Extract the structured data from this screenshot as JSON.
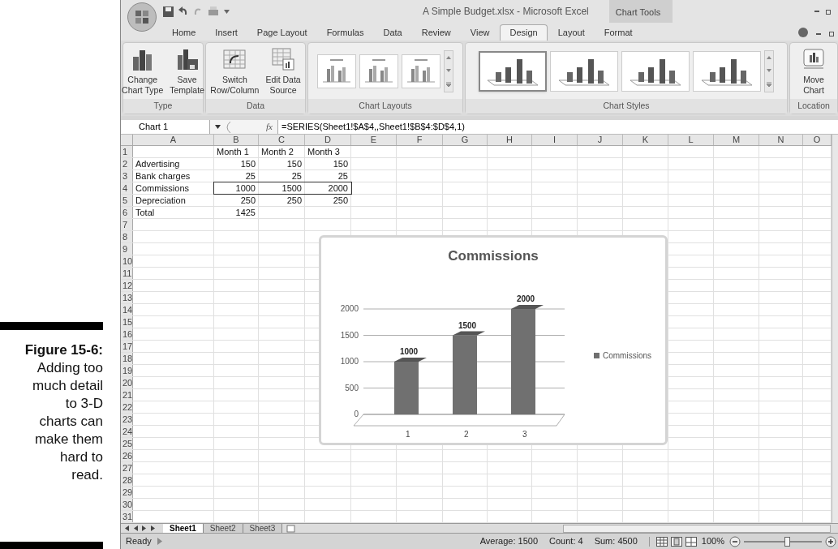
{
  "caption": {
    "label": "Figure 15-6:",
    "text": "Adding too much detail to 3-D charts can make them hard to read."
  },
  "window": {
    "title": "A Simple Budget.xlsx - Microsoft Excel",
    "contextual_group": "Chart Tools"
  },
  "ribbon_tabs": [
    {
      "label": "Home",
      "selected": false
    },
    {
      "label": "Insert",
      "selected": false
    },
    {
      "label": "Page Layout",
      "selected": false
    },
    {
      "label": "Formulas",
      "selected": false
    },
    {
      "label": "Data",
      "selected": false
    },
    {
      "label": "Review",
      "selected": false
    },
    {
      "label": "View",
      "selected": false
    },
    {
      "label": "Design",
      "selected": true
    },
    {
      "label": "Layout",
      "selected": false
    },
    {
      "label": "Format",
      "selected": false
    }
  ],
  "ribbon_groups": [
    {
      "label": "Type",
      "kind": "buttons",
      "buttons": [
        {
          "lines": [
            "Change",
            "Chart Type"
          ]
        },
        {
          "lines": [
            "Save",
            "Template"
          ]
        }
      ]
    },
    {
      "label": "Data",
      "kind": "buttons",
      "buttons": [
        {
          "lines": [
            "Switch",
            "Row/Column"
          ]
        },
        {
          "lines": [
            "Edit Data",
            "Source"
          ]
        }
      ]
    },
    {
      "label": "Chart Layouts",
      "kind": "gallery",
      "items": [
        {
          "selected": false
        },
        {
          "selected": false
        },
        {
          "selected": false
        }
      ]
    },
    {
      "label": "Chart Styles",
      "kind": "gallery",
      "items": [
        {
          "selected": true
        },
        {
          "selected": false
        },
        {
          "selected": false
        },
        {
          "selected": false
        }
      ]
    },
    {
      "label": "Location",
      "kind": "buttons",
      "buttons": [
        {
          "lines": [
            "Move",
            "Chart"
          ]
        }
      ]
    }
  ],
  "formula_bar": {
    "name_box": "Chart 1",
    "function_label": "fx",
    "formula": "=SERIES(Sheet1!$A$4,,Sheet1!$B$4:$D$4,1)"
  },
  "sheet": {
    "columns": [
      "A",
      "B",
      "C",
      "D",
      "E",
      "F",
      "G",
      "H",
      "I",
      "J",
      "K",
      "L",
      "M",
      "N",
      "O"
    ],
    "rows": [
      {
        "number": "1",
        "kind": "header",
        "values": [
          "Month 1",
          "Month 2",
          "Month 3"
        ],
        "highlighted": false
      },
      {
        "number": "2",
        "kind": "data",
        "label": "Advertising",
        "values": [
          "150",
          "150",
          "150"
        ],
        "highlighted": false
      },
      {
        "number": "3",
        "kind": "data",
        "label": "Bank charges",
        "values": [
          "25",
          "25",
          "25"
        ],
        "highlighted": false
      },
      {
        "number": "4",
        "kind": "data",
        "label": "Commissions",
        "values": [
          "1000",
          "1500",
          "2000"
        ],
        "highlighted": true
      },
      {
        "number": "5",
        "kind": "data",
        "label": "Depreciation",
        "values": [
          "250",
          "250",
          "250"
        ],
        "highlighted": false
      },
      {
        "number": "6",
        "kind": "data",
        "label": "Total",
        "values": [
          "1425"
        ],
        "highlighted": false
      },
      {
        "number": "7",
        "kind": "data",
        "highlighted": false
      },
      {
        "number": "8",
        "kind": "data",
        "highlighted": false
      },
      {
        "number": "9",
        "kind": "data",
        "highlighted": false
      },
      {
        "number": "10",
        "kind": "data",
        "highlighted": false
      },
      {
        "number": "11",
        "kind": "data",
        "highlighted": false
      },
      {
        "number": "12",
        "kind": "data",
        "highlighted": false
      },
      {
        "number": "13",
        "kind": "data",
        "highlighted": false
      },
      {
        "number": "14",
        "kind": "data",
        "highlighted": false
      },
      {
        "number": "15",
        "kind": "data",
        "highlighted": false
      },
      {
        "number": "16",
        "kind": "data",
        "highlighted": false
      },
      {
        "number": "17",
        "kind": "data",
        "highlighted": false
      },
      {
        "number": "18",
        "kind": "data",
        "highlighted": false
      },
      {
        "number": "19",
        "kind": "data",
        "highlighted": false
      },
      {
        "number": "20",
        "kind": "data",
        "highlighted": false
      },
      {
        "number": "21",
        "kind": "data",
        "highlighted": false
      },
      {
        "number": "22",
        "kind": "data",
        "highlighted": false
      },
      {
        "number": "23",
        "kind": "data",
        "highlighted": false
      },
      {
        "number": "24",
        "kind": "data",
        "highlighted": false
      },
      {
        "number": "25",
        "kind": "data",
        "highlighted": false
      },
      {
        "number": "26",
        "kind": "data",
        "highlighted": false
      },
      {
        "number": "27",
        "kind": "data",
        "highlighted": false
      },
      {
        "number": "28",
        "kind": "data",
        "highlighted": false
      },
      {
        "number": "29",
        "kind": "data",
        "highlighted": false
      },
      {
        "number": "30",
        "kind": "data",
        "highlighted": false
      },
      {
        "number": "31",
        "kind": "data",
        "highlighted": false
      }
    ]
  },
  "chart": {
    "chart_data": {
      "type": "bar",
      "title": "Commissions",
      "categories": [
        "1",
        "2",
        "3"
      ],
      "series": [
        {
          "name": "Commissions",
          "color": "#707070",
          "values": [
            1000,
            1500,
            2000
          ]
        }
      ],
      "ylim": [
        0,
        2000
      ],
      "yticks": [
        {
          "value": 0,
          "label": "0"
        },
        {
          "value": 500,
          "label": "500"
        },
        {
          "value": 1000,
          "label": "1000"
        },
        {
          "value": 1500,
          "label": "1500"
        },
        {
          "value": 2000,
          "label": "2000"
        }
      ],
      "data_labels": true,
      "grid": true
    }
  },
  "sheet_tabs": [
    {
      "label": "Sheet1",
      "selected": true
    },
    {
      "label": "Sheet2",
      "selected": false
    },
    {
      "label": "Sheet3",
      "selected": false
    }
  ],
  "status_bar": {
    "mode": "Ready",
    "average": "Average: 1500",
    "count": "Count: 4",
    "sum": "Sum: 4500",
    "zoom": "100%",
    "zoom_level": {
      "level": 0.55
    }
  }
}
